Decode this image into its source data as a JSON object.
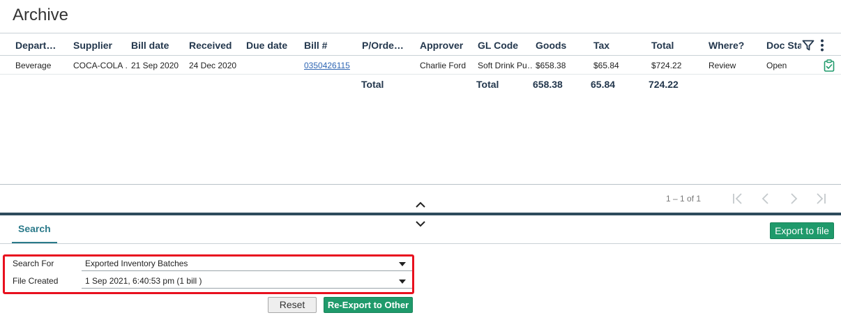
{
  "page": {
    "title": "Archive"
  },
  "grid": {
    "columns": [
      "Depart…",
      "Supplier",
      "Bill date",
      "Received",
      "Due date",
      "Bill #",
      "P/Orde…",
      "Approver",
      "GL Code",
      "Goods",
      "Tax",
      "Total",
      "Where?",
      "Doc Sta"
    ],
    "rows": [
      {
        "department": "Beverage",
        "supplier": "COCA-COLA …",
        "bill_date": "21 Sep 2020",
        "received": "24 Dec 2020",
        "due_date": "",
        "bill_no": "0350426115",
        "po": "",
        "approver": "Charlie Ford",
        "gl_code": "Soft Drink Pu…",
        "goods": "$658.38",
        "tax": "$65.84",
        "total": "$724.22",
        "where": "Review",
        "doc_status": "Open"
      }
    ],
    "totals": {
      "label_left": "Total",
      "label_right": "Total",
      "goods": "658.38",
      "tax": "65.84",
      "total": "724.22"
    },
    "icons": {
      "filter": "filter-icon",
      "more": "more-vertical-icon",
      "row_action": "clipboard-check-icon"
    }
  },
  "pager": {
    "range_text": "1 – 1 of 1"
  },
  "bottom_panel": {
    "tabs": [
      {
        "label": "Search"
      }
    ],
    "export_button": "Export to file",
    "form": {
      "search_for": {
        "label": "Search For",
        "value": "Exported Inventory Batches"
      },
      "file_created": {
        "label": "File Created",
        "value": "1 Sep 2021, 6:40:53 pm (1 bill )"
      }
    },
    "reset_button": "Reset",
    "reexport_button": "Re-Export to Other"
  },
  "colors": {
    "accent_green": "#1f9a6b",
    "header_text": "#23374d",
    "splitter": "#2d4b5c",
    "highlight": "#e8101e",
    "link": "#2f66b3"
  }
}
